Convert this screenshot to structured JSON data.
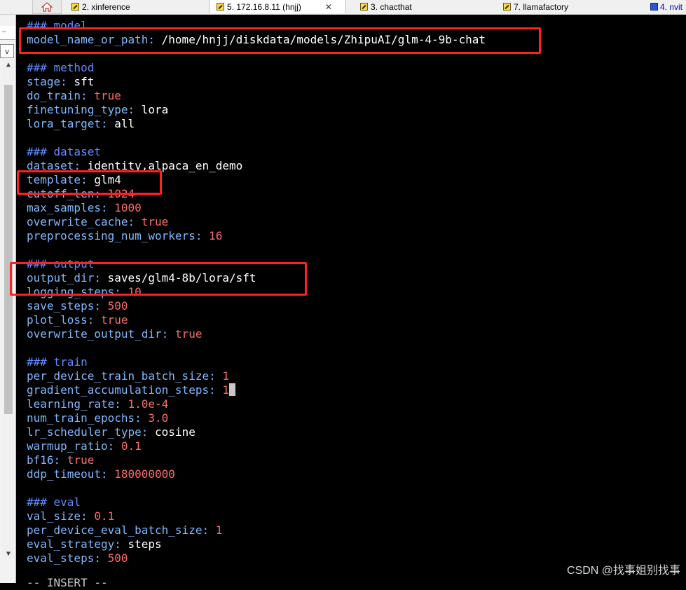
{
  "tabs": [
    {
      "label": "2. xinference"
    },
    {
      "label": "5. 172.16.8.11 (hnjj)",
      "close": "✕"
    },
    {
      "label": "3. chacthat"
    },
    {
      "label": "7. llamafactory"
    },
    {
      "label": "4. nvit"
    }
  ],
  "side": {
    "field_text": "—",
    "combo_icon": "v",
    "scroll_up": "▲",
    "scroll_down": "▼"
  },
  "config": {
    "sec_model": "### model",
    "model_name_or_path": {
      "key": "model_name_or_path",
      "value": "/home/hnjj/diskdata/models/ZhipuAI/glm-4-9b-chat"
    },
    "sec_method": "### method",
    "stage": {
      "key": "stage",
      "value": "sft"
    },
    "do_train": {
      "key": "do_train",
      "value": "true"
    },
    "finetuning_type": {
      "key": "finetuning_type",
      "value": "lora"
    },
    "lora_target": {
      "key": "lora_target",
      "value": "all"
    },
    "sec_dataset": "### dataset",
    "dataset": {
      "key": "dataset",
      "value": "identity,alpaca_en_demo"
    },
    "template": {
      "key": "template",
      "value": "glm4"
    },
    "cutoff_len": {
      "key": "cutoff_len",
      "value": "1024"
    },
    "max_samples": {
      "key": "max_samples",
      "value": "1000"
    },
    "overwrite_cache": {
      "key": "overwrite_cache",
      "value": "true"
    },
    "preprocessing_num_workers": {
      "key": "preprocessing_num_workers",
      "value": "16"
    },
    "sec_output": "### output",
    "output_dir": {
      "key": "output_dir",
      "value": "saves/glm4-8b/lora/sft"
    },
    "logging_steps": {
      "key": "logging_steps",
      "value": "10"
    },
    "save_steps": {
      "key": "save_steps",
      "value": "500"
    },
    "plot_loss": {
      "key": "plot_loss",
      "value": "true"
    },
    "overwrite_output_dir": {
      "key": "overwrite_output_dir",
      "value": "true"
    },
    "sec_train": "### train",
    "per_device_train_batch_size": {
      "key": "per_device_train_batch_size",
      "value": "1"
    },
    "gradient_accumulation_steps": {
      "key": "gradient_accumulation_steps",
      "value": "1"
    },
    "learning_rate": {
      "key": "learning_rate",
      "value": "1.0e-4"
    },
    "num_train_epochs": {
      "key": "num_train_epochs",
      "value": "3.0"
    },
    "lr_scheduler_type": {
      "key": "lr_scheduler_type",
      "value": "cosine"
    },
    "warmup_ratio": {
      "key": "warmup_ratio",
      "value": "0.1"
    },
    "bf16": {
      "key": "bf16",
      "value": "true"
    },
    "ddp_timeout": {
      "key": "ddp_timeout",
      "value": "180000000"
    },
    "sec_eval": "### eval",
    "val_size": {
      "key": "val_size",
      "value": "0.1"
    },
    "per_device_eval_batch_size": {
      "key": "per_device_eval_batch_size",
      "value": "1"
    },
    "eval_strategy": {
      "key": "eval_strategy",
      "value": "steps"
    },
    "eval_steps": {
      "key": "eval_steps",
      "value": "500"
    }
  },
  "sep": ": ",
  "status_partial": "-- INSERT --",
  "watermark": "CSDN @找事姐别找事",
  "colors": {
    "key": "#7fb8ff",
    "number": "#ff6b6b",
    "comment": "#5f8cff",
    "highlight_box": "#ff2020"
  }
}
